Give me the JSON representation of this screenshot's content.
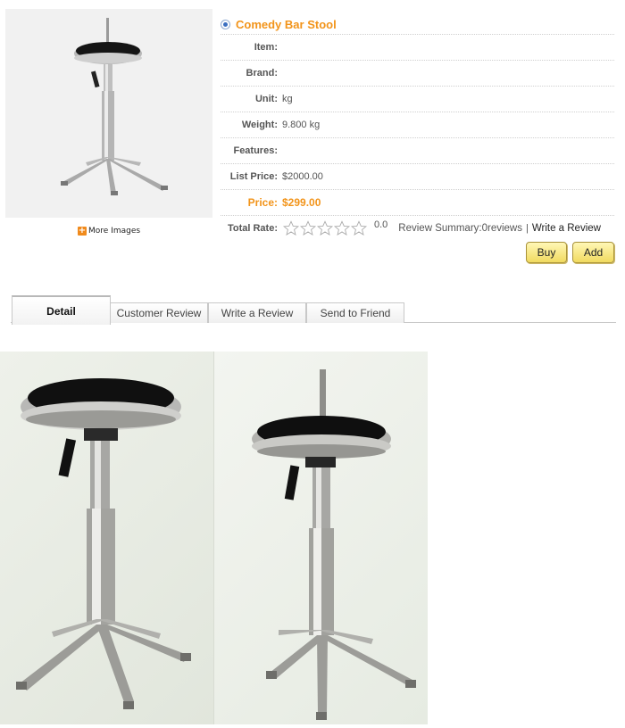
{
  "product": {
    "title": "Comedy Bar Stool",
    "more_images_label": "More Images",
    "fields": [
      {
        "label": "Item",
        "value": ""
      },
      {
        "label": "Brand",
        "value": ""
      },
      {
        "label": "Unit",
        "value": "kg"
      },
      {
        "label": "Weight",
        "value": "9.800 kg"
      },
      {
        "label": "Features",
        "value": ""
      },
      {
        "label": "List Price",
        "value": "$2000.00"
      }
    ],
    "price": {
      "label": "Price",
      "value": "$299.00"
    },
    "rating": {
      "label": "Total Rate",
      "stars_filled": 0,
      "stars_total": 5,
      "score": "0.0",
      "summary": "Review Summary:0reviews",
      "separator": "|",
      "write_link": "Write a Review"
    },
    "buttons": {
      "buy": "Buy",
      "add": "Add"
    }
  },
  "tabs": [
    {
      "label": "Detail",
      "active": true
    },
    {
      "label": "Customer Review",
      "active": false
    },
    {
      "label": "Write a Review",
      "active": false
    },
    {
      "label": "Send to Friend",
      "active": false
    }
  ],
  "colors": {
    "accent_orange": "#f2941a",
    "button_yellow": "#f1da5f",
    "radio_blue": "#3a6fc0"
  }
}
